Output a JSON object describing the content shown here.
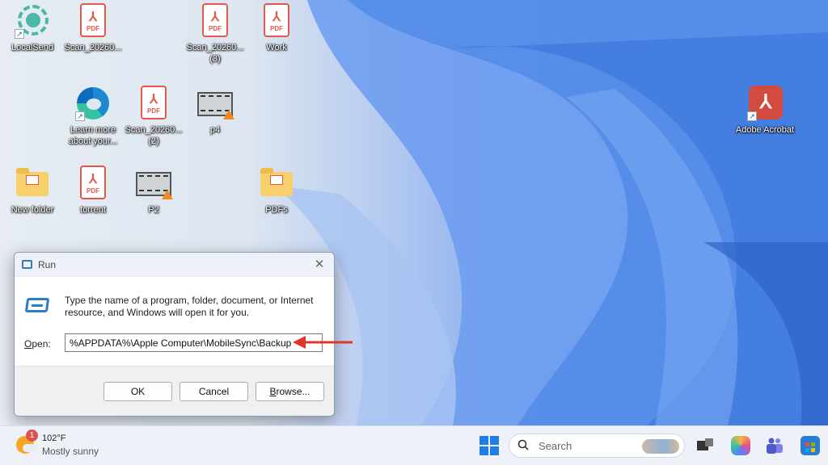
{
  "desktop": {
    "icons": [
      {
        "label": "LocalSend",
        "icon": "localsend-icon"
      },
      {
        "label": "Scan_20260...",
        "icon": "pdf-file-icon"
      },
      {
        "label": "Scan_20260... (3)",
        "icon": "pdf-file-icon"
      },
      {
        "label": "Work",
        "icon": "pdf-file-icon"
      },
      {
        "label": "Learn more about your...",
        "icon": "edge-icon"
      },
      {
        "label": "Scan_20260... (2)",
        "icon": "pdf-file-icon"
      },
      {
        "label": "p4",
        "icon": "video-file-icon"
      },
      {
        "label": "Adobe Acrobat",
        "icon": "adobe-acrobat-icon"
      },
      {
        "label": "New folder",
        "icon": "folder-icon"
      },
      {
        "label": "torrent",
        "icon": "pdf-file-icon"
      },
      {
        "label": "P2",
        "icon": "video-file-icon"
      },
      {
        "label": "PDFs",
        "icon": "folder-icon"
      }
    ],
    "pdf_badge": "PDF"
  },
  "run_dialog": {
    "title": "Run",
    "close_glyph": "✕",
    "description": "Type the name of a program, folder, document, or Internet resource, and Windows will open it for you.",
    "open_label_accel": "O",
    "open_label_rest": "pen:",
    "open_value": "%APPDATA%\\Apple Computer\\MobileSync\\Backup",
    "ok_label": "OK",
    "cancel_label": "Cancel",
    "browse_label_accel": "B",
    "browse_label_rest": "rowse..."
  },
  "taskbar": {
    "weather": {
      "badge": "1",
      "temp": "102°F",
      "condition": "Mostly sunny"
    },
    "search_placeholder": "Search"
  },
  "colors": {
    "accent": "#1f7ee6",
    "pdf_red": "#e4584a",
    "annotation_arrow": "#e0352b"
  }
}
